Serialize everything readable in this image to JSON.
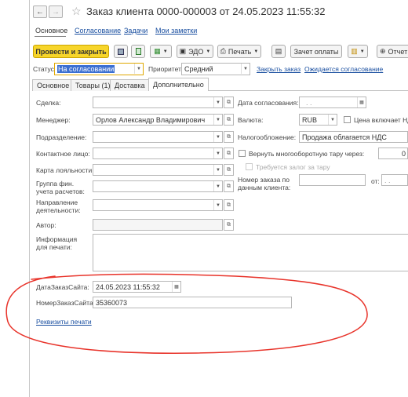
{
  "window": {
    "title": "Заказ клиента 0000-000003 от 24.05.2023 11:55:32"
  },
  "nav": {
    "back": "←",
    "forward": "→",
    "star": "☆"
  },
  "top_tabs": [
    "Основное",
    "Согласование",
    "Задачи",
    "Мои заметки"
  ],
  "toolbar": {
    "post_close": "Провести и закрыть",
    "edo": "ЭДО",
    "print": "Печать",
    "offset": "Зачет оплаты",
    "report": "Отчет"
  },
  "status_row": {
    "status_label": "Статус:",
    "status_value": "На согласовании",
    "priority_label": "Приоритет:",
    "priority_value": "Средний",
    "close_link": "Закрыть заказ",
    "awaiting_link": "Ожидается согласование"
  },
  "tabs": [
    "Основное",
    "Товары (1)",
    "Доставка",
    "Дополнительно"
  ],
  "left": {
    "deal_label": "Сделка:",
    "manager_label": "Менеджер:",
    "manager_value": "Орлов Александр Владимирович",
    "division_label": "Подразделение:",
    "contact_label": "Контактное лицо:",
    "loyalty_label": "Карта лояльности:",
    "fin_group_label": "Группа фин. учета расчетов:",
    "direction_label": "Направление деятельности:",
    "author_label": "Автор:",
    "print_info_label": "Информация для печати:"
  },
  "right": {
    "approve_date_label": "Дата согласования:",
    "approve_date_value": ". .",
    "currency_label": "Валюта:",
    "currency_value": "RUB",
    "price_vat_label": "Цена включает НДС",
    "tax_label": "Налогообложение:",
    "tax_value": "Продажа облагается НДС",
    "return_tare_label": "Вернуть многооборотную тару через:",
    "return_tare_value": "0",
    "deposit_label": "Требуется залог за тару",
    "order_num_label": "Номер заказа по данным клиента:",
    "from_label": "от:",
    "from_value": ". ."
  },
  "extra": {
    "site_date_label": "ДатаЗаказСайта:",
    "site_date_value": "24.05.2023 11:55:32",
    "site_num_label": "НомерЗаказСайта:",
    "site_num_value": "35360073",
    "print_details_link": "Реквизиты печати"
  },
  "colors": {
    "primary_button": "#f7d52a",
    "link": "#1a4fa0",
    "annotation": "#e8332a"
  }
}
